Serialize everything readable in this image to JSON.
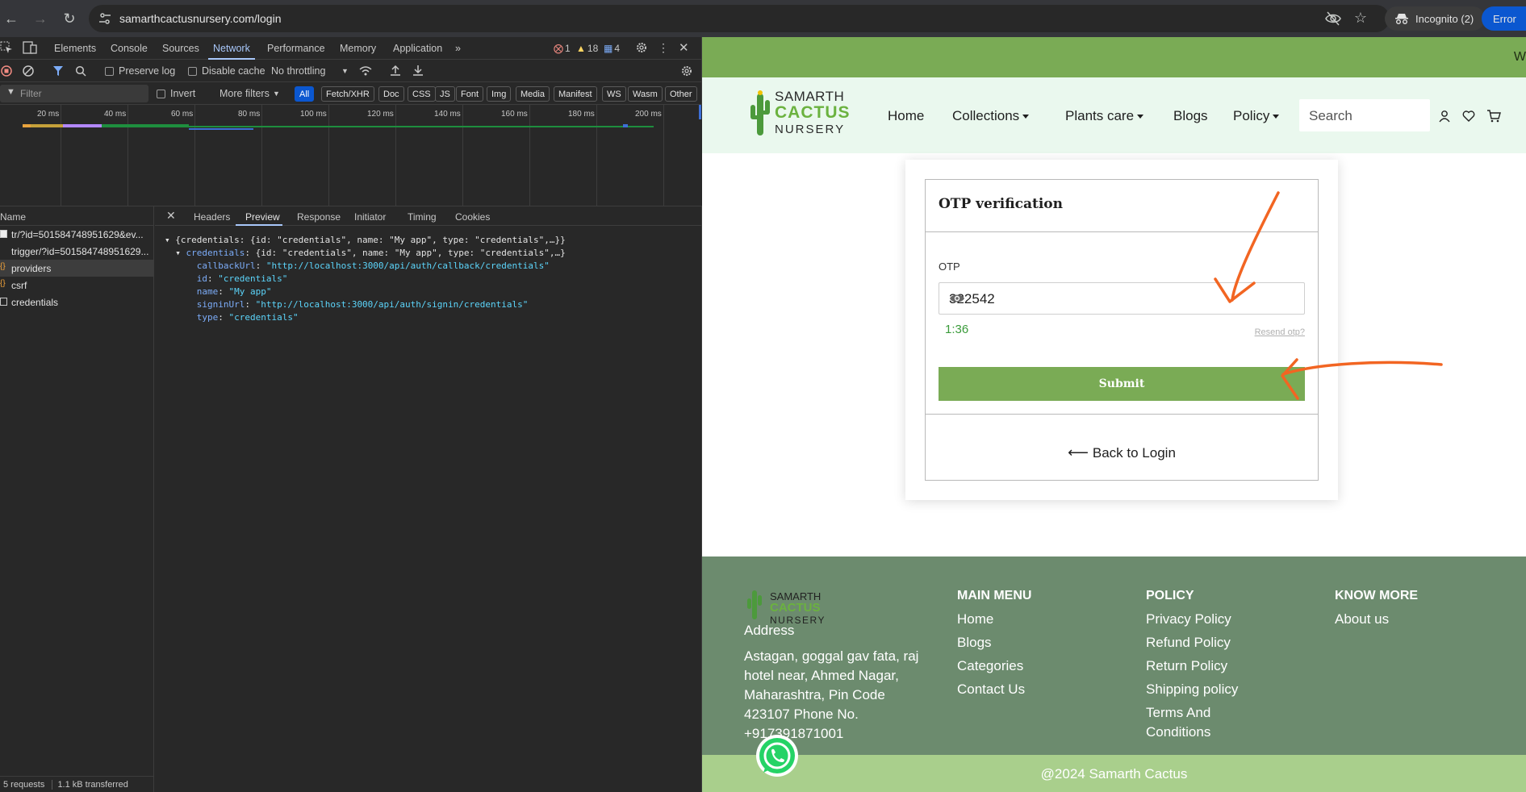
{
  "browser": {
    "url": "samarthcactusnursery.com/login",
    "incognito_label": "Incognito (2)",
    "error_label": "Error"
  },
  "devtools": {
    "tabs": [
      "Elements",
      "Console",
      "Sources",
      "Network",
      "Performance",
      "Memory",
      "Application"
    ],
    "counts": {
      "errors": "1",
      "warnings": "18",
      "messages": "4"
    },
    "toolbar": {
      "preserve_log": "Preserve log",
      "disable_cache": "Disable cache",
      "throttling": "No throttling"
    },
    "filter": {
      "placeholder": "Filter",
      "invert": "Invert",
      "more_filters": "More filters",
      "types": [
        "All",
        "Fetch/XHR",
        "Doc",
        "CSS",
        "JS",
        "Font",
        "Img",
        "Media",
        "Manifest",
        "WS",
        "Wasm",
        "Other"
      ]
    },
    "timeline_ticks": [
      "20 ms",
      "40 ms",
      "60 ms",
      "80 ms",
      "100 ms",
      "120 ms",
      "140 ms",
      "160 ms",
      "180 ms",
      "200 ms"
    ],
    "name_header": "Name",
    "requests": [
      "tr/?id=501584748951629&ev...",
      "trigger/?id=501584748951629...",
      "providers",
      "csrf",
      "credentials"
    ],
    "status": {
      "requests": "5 requests",
      "transferred": "1.1 kB transferred"
    },
    "detail_tabs": [
      "Headers",
      "Preview",
      "Response",
      "Initiator",
      "Timing",
      "Cookies"
    ],
    "preview": {
      "root": "{credentials: {id: \"credentials\", name: \"My app\", type: \"credentials\",…}}",
      "child_key": "credentials",
      "child_summary": "{id: \"credentials\", name: \"My app\", type: \"credentials\",…}",
      "fields": [
        {
          "key": "callbackUrl",
          "value": "\"http://localhost:3000/api/auth/callback/credentials\""
        },
        {
          "key": "id",
          "value": "\"credentials\""
        },
        {
          "key": "name",
          "value": "\"My app\""
        },
        {
          "key": "signinUrl",
          "value": "\"http://localhost:3000/api/auth/signin/credentials\""
        },
        {
          "key": "type",
          "value": "\"credentials\""
        }
      ]
    }
  },
  "site": {
    "banner_text": "W",
    "logo": {
      "line1": "SAMARTH",
      "line2": "CACTUS",
      "line3": "NURSERY"
    },
    "nav": [
      "Home",
      "Collections",
      "Plants care",
      "Blogs",
      "Policy"
    ],
    "search_placeholder": "Search",
    "otp": {
      "title": "OTP verification",
      "label": "OTP",
      "value": "322542",
      "timer": "1:36",
      "resend": "Resend otp?",
      "submit": "Submit",
      "back": "Back to Login"
    },
    "footer": {
      "address_title": "Address",
      "address": "Astagan, goggal gav fata, raj hotel near, Ahmed Nagar, Maharashtra, Pin Code 423107 Phone No. +917391871001",
      "main_menu": {
        "title": "MAIN MENU",
        "items": [
          "Home",
          "Blogs",
          "Categories",
          "Contact Us"
        ]
      },
      "policy": {
        "title": "POLICY",
        "items": [
          "Privacy Policy",
          "Refund Policy",
          "Return Policy",
          "Shipping policy",
          "Terms And",
          "Conditions"
        ]
      },
      "know_more": {
        "title": "KNOW MORE",
        "items": [
          "About us"
        ]
      },
      "copyright": "@2024 Samarth Cactus"
    },
    "colors": {
      "brand_green": "#7aab55",
      "footer_bg": "#6c8b6e",
      "annotation": "#f26522"
    }
  }
}
